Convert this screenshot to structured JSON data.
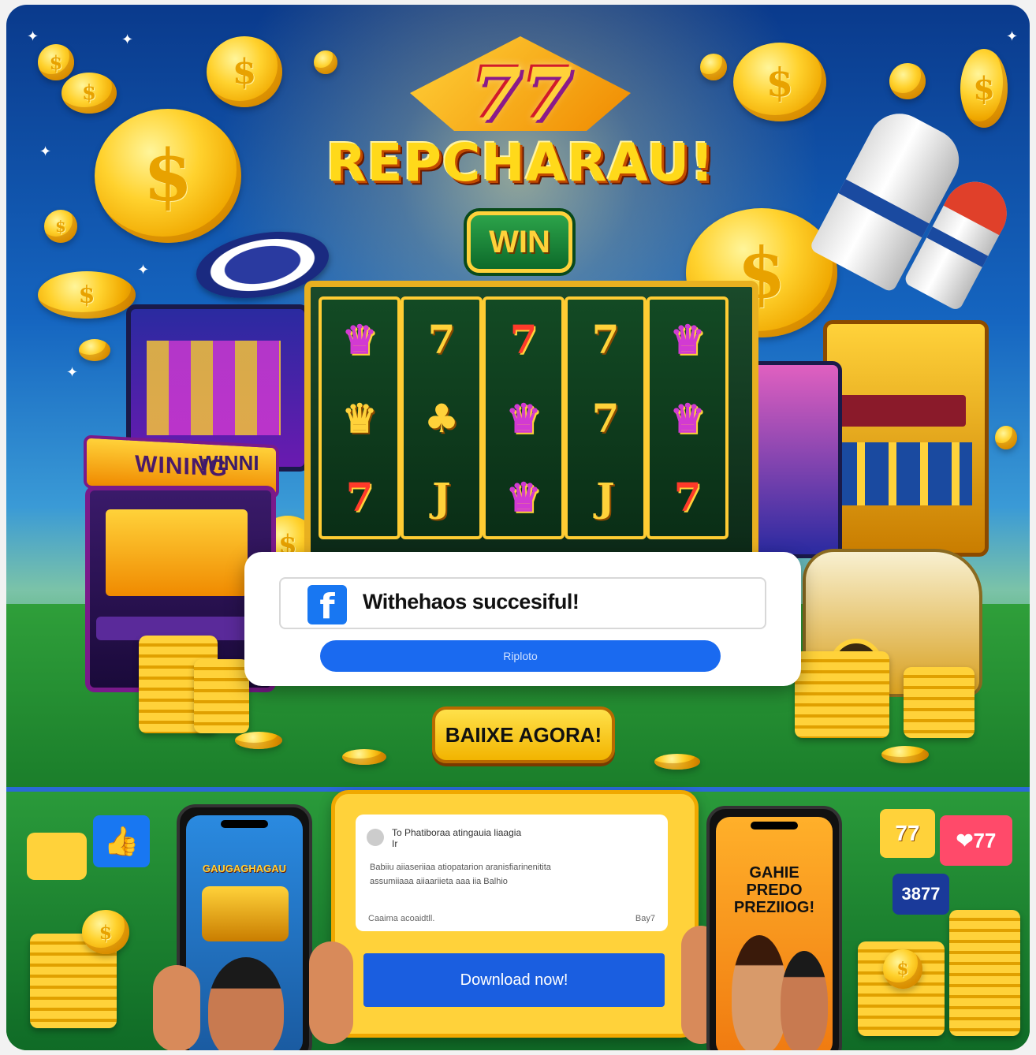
{
  "hero": {
    "logo_number": "77",
    "title": "REPCHARAU!",
    "win_badge": "WIN",
    "machine_sign_left": "WINING",
    "machine_sign_right": "WINNI",
    "coin_symbol": "$"
  },
  "dialog": {
    "icon": "facebook-icon",
    "message": "Withehaos succesiful!",
    "button_label": "Riploto"
  },
  "cta": {
    "label": "BAIIXE AGORA!"
  },
  "bottom": {
    "left_phone_title": "GAUGAGHAGAU",
    "right_phone_title": "GAHIE PREDO PREZIIOG!",
    "card": {
      "header": "To Phatiboraa atingauia liaagia",
      "header_sub": "Ir",
      "body_line1": "Babiiu aiiaseriiaa atiopatarion aranisfiarinenitita",
      "body_line2": "assumiiaaa aiiaariieta aaa iia Balhio",
      "footer_left": "Caaima acoaidtll.",
      "footer_right": "Bay7",
      "button_label": "Download now!"
    },
    "bubble_77": "77",
    "bubble_heart_77": "77",
    "bubble_count": "3877"
  },
  "colors": {
    "facebook_blue": "#1877f2",
    "cta_yellow": "#ffd23a",
    "download_blue": "#1a5ee0"
  }
}
